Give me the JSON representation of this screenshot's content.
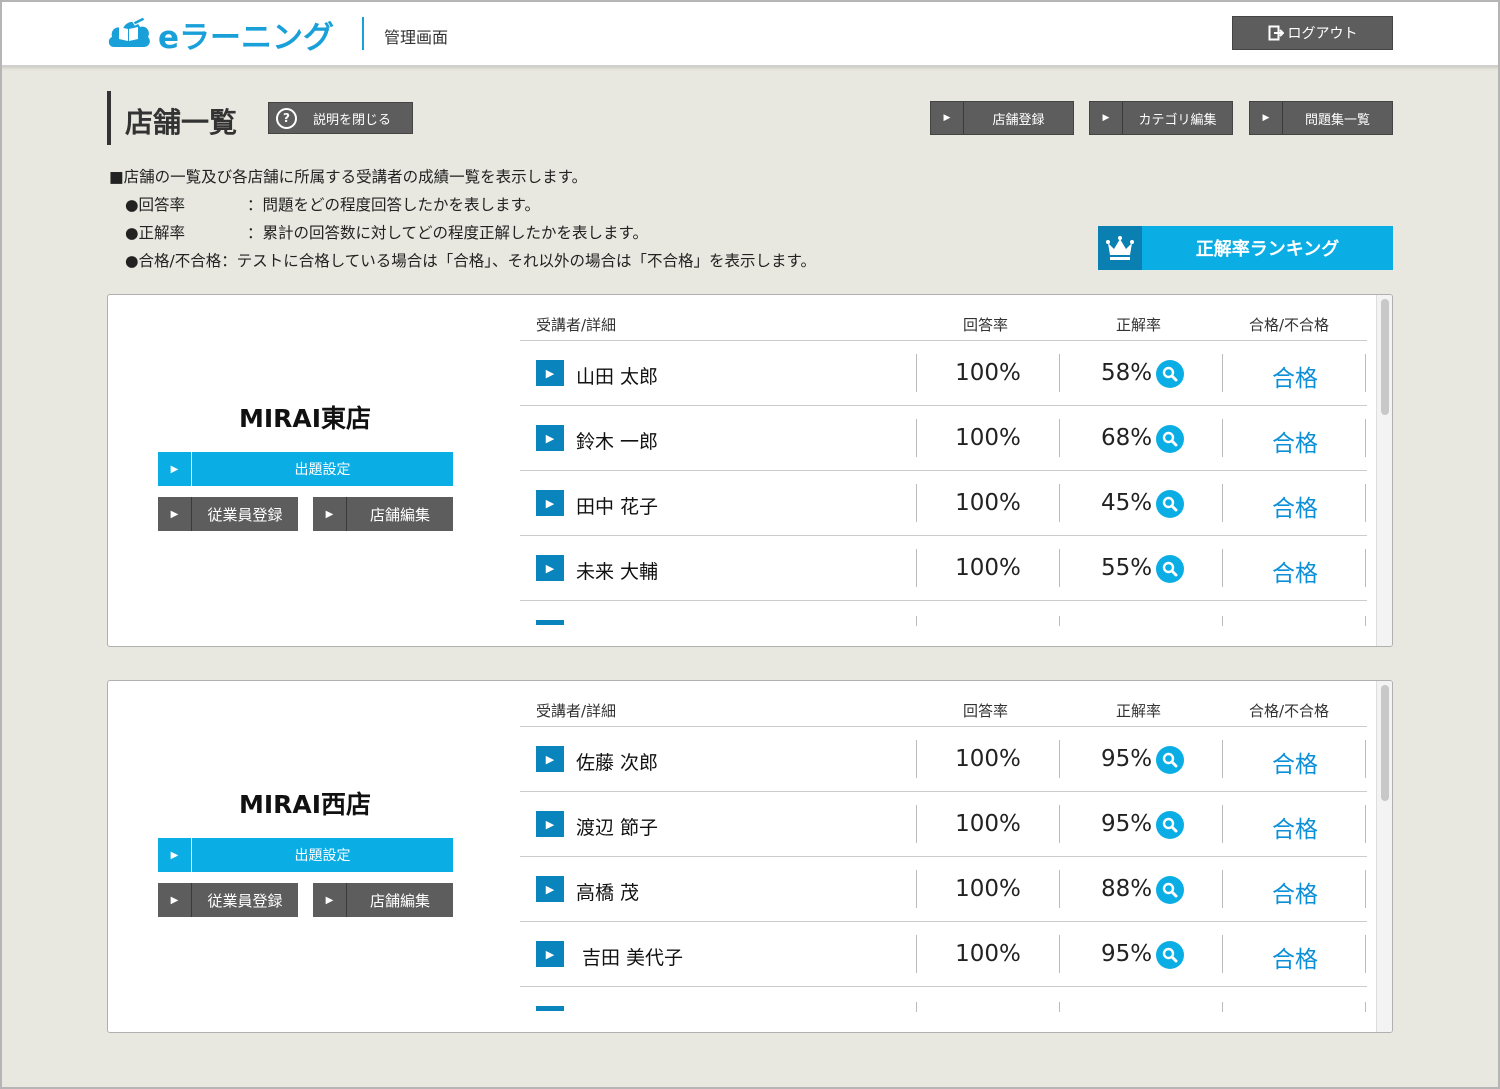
{
  "header": {
    "logo_text": "eラーニング",
    "admin_label": "管理画面",
    "logout_label": "ログアウト"
  },
  "title": {
    "page_title": "店舗一覧",
    "help_label": "説明を閉じる"
  },
  "nav": {
    "store_register": "店舗登録",
    "category_edit": "カテゴリ編集",
    "question_list": "問題集一覧"
  },
  "description": {
    "intro": "■店舗の一覧及び各店舗に所属する受講者の成績一覧を表示します。",
    "items": [
      {
        "key": "●回答率",
        "text": "：問題をどの程度回答したかを表します。"
      },
      {
        "key": "●正解率",
        "text": "：累計の回答数に対してどの程度正解したかを表します。"
      },
      {
        "key": "●合格/不合格",
        "text": "：テストに合格している場合は「合格」、それ以外の場合は「不合格」を表示します。"
      }
    ]
  },
  "ranking_label": "正解率ランキング",
  "table_headers": {
    "trainee": "受講者/詳細",
    "answer_rate": "回答率",
    "accuracy": "正解率",
    "pass_fail": "合格/不合格"
  },
  "store_buttons": {
    "question_settings": "出題設定",
    "employee_register": "従業員登録",
    "store_edit": "店舗編集"
  },
  "stores": [
    {
      "name": "MIRAI東店",
      "rows": [
        {
          "name": "山田 太郎",
          "answer_rate": "100%",
          "accuracy": "58%",
          "result": "合格"
        },
        {
          "name": "鈴木 一郎",
          "answer_rate": "100%",
          "accuracy": "68%",
          "result": "合格"
        },
        {
          "name": "田中 花子",
          "answer_rate": "100%",
          "accuracy": "45%",
          "result": "合格"
        },
        {
          "name": "未来 大輔",
          "answer_rate": "100%",
          "accuracy": "55%",
          "result": "合格"
        }
      ]
    },
    {
      "name": "MIRAI西店",
      "rows": [
        {
          "name": "佐藤 次郎",
          "answer_rate": "100%",
          "accuracy": "95%",
          "result": "合格"
        },
        {
          "name": "渡辺 節子",
          "answer_rate": "100%",
          "accuracy": "95%",
          "result": "合格"
        },
        {
          "name": "高橋 茂",
          "answer_rate": "100%",
          "accuracy": "88%",
          "result": "合格"
        },
        {
          "name": "吉田 美代子",
          "answer_rate": "100%",
          "accuracy": "95%",
          "result": "合格"
        }
      ]
    }
  ],
  "icons": {
    "logo": "book-cloud-icon",
    "logout": "logout-icon",
    "help": "question-circle-icon",
    "nav_arrow": "play-arrow-icon",
    "ranking": "crown-icon",
    "detail": "magnifier-icon"
  },
  "colors": {
    "accent_blue": "#0baee4",
    "dark_blue": "#0a84bd",
    "button_gray": "#5d5d5d",
    "background": "#e8e8e0",
    "pass_text": "#0a8fd8"
  }
}
